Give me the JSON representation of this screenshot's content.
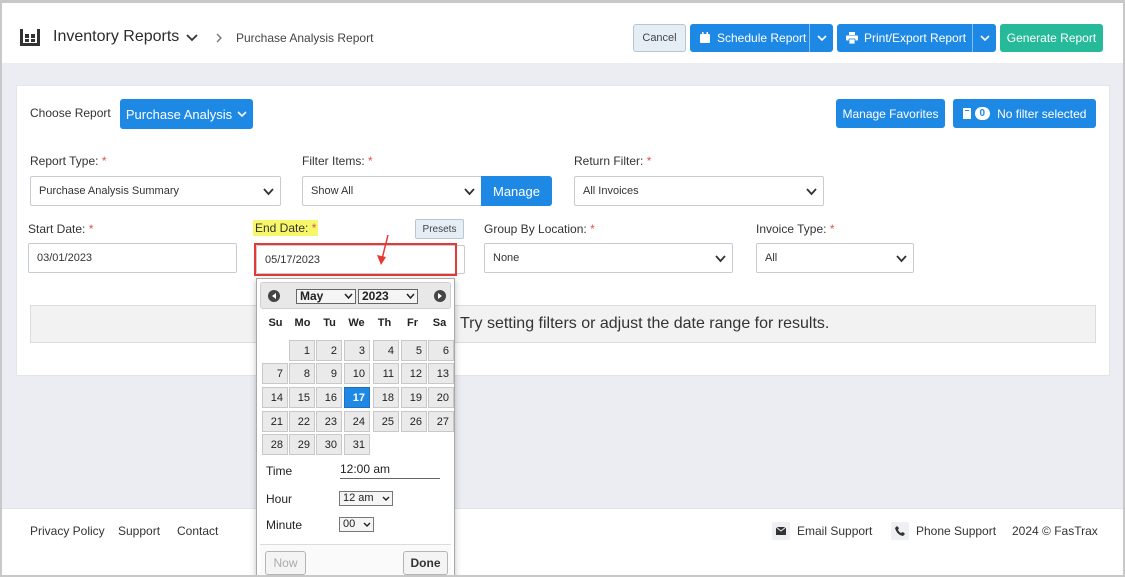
{
  "header": {
    "app_title": "Inventory Reports",
    "breadcrumb_current": "Purchase Analysis Report",
    "cancel_label": "Cancel",
    "schedule_label": "Schedule Report",
    "print_label": "Print/Export Report",
    "generate_label": "Generate Report"
  },
  "report": {
    "choose_label": "Choose Report",
    "selected_report": "Purchase Analysis",
    "favorites_label": "Manage Favorites",
    "filter_count": "0",
    "filter_label": "No filter selected"
  },
  "filters": {
    "report_type_label": "Report Type:",
    "report_type_value": "Purchase Analysis Summary",
    "filter_items_label": "Filter Items:",
    "filter_items_value": "Show All",
    "manage_label": "Manage",
    "return_filter_label": "Return Filter:",
    "return_filter_value": "All Invoices",
    "start_date_label": "Start Date:",
    "start_date_value": "03/01/2023",
    "end_date_label": "End Date:",
    "end_date_value": "05/17/2023",
    "presets_label": "Presets",
    "group_by_label": "Group By Location:",
    "group_by_value": "None",
    "invoice_type_label": "Invoice Type:",
    "invoice_type_value": "All",
    "required_mark": "*"
  },
  "results_message": "Try setting filters or adjust the date range for results.",
  "datepicker": {
    "month": "May",
    "year": "2023",
    "weekdays": [
      "Su",
      "Mo",
      "Tu",
      "We",
      "Th",
      "Fr",
      "Sa"
    ],
    "days": [
      "1",
      "2",
      "3",
      "4",
      "5",
      "6",
      "7",
      "8",
      "9",
      "10",
      "11",
      "12",
      "13",
      "14",
      "15",
      "16",
      "17",
      "18",
      "19",
      "20",
      "21",
      "22",
      "23",
      "24",
      "25",
      "26",
      "27",
      "28",
      "29",
      "30",
      "31"
    ],
    "selected_day": "17",
    "first_weekday": 1,
    "time_label": "Time",
    "time_value": "12:00 am",
    "hour_label": "Hour",
    "hour_value": "12 am",
    "minute_label": "Minute",
    "minute_value": "00",
    "now_label": "Now",
    "done_label": "Done"
  },
  "footer": {
    "privacy": "Privacy Policy",
    "support": "Support",
    "contact": "Contact",
    "email_support": "Email Support",
    "phone_support": "Phone Support",
    "copyright": "2024 © FasTrax"
  },
  "colors": {
    "primary": "#1e88e5",
    "success": "#26b99a",
    "required": "#d9534f",
    "highlight": "#f7f76a",
    "annotation": "#e53935"
  }
}
